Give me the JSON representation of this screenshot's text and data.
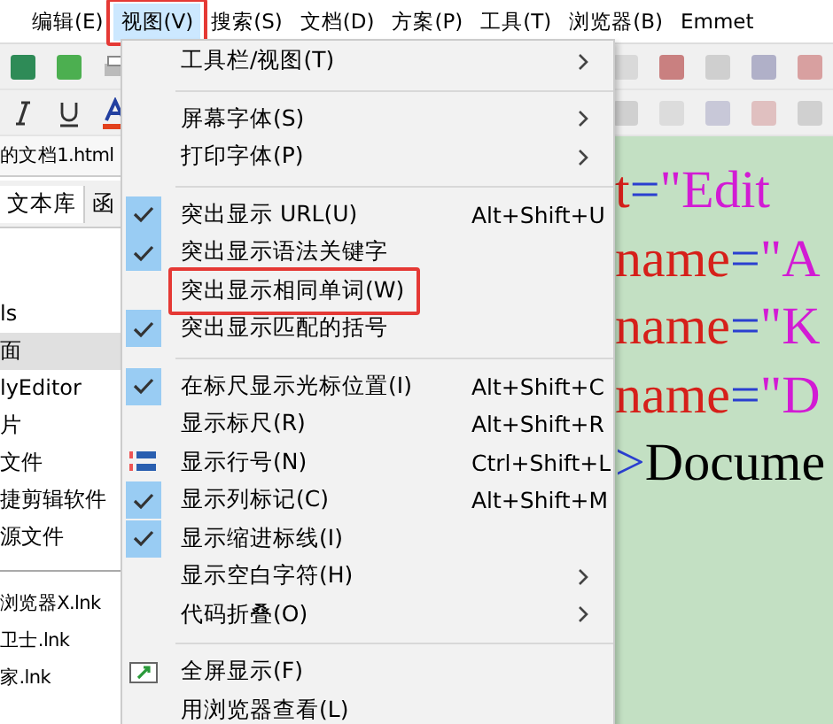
{
  "menu_bar": [
    {
      "label": "编辑(E)",
      "selected": false
    },
    {
      "label": "视图(V)",
      "selected": true
    },
    {
      "label": "搜索(S)",
      "selected": false
    },
    {
      "label": "文档(D)",
      "selected": false
    },
    {
      "label": "方案(P)",
      "selected": false
    },
    {
      "label": "工具(T)",
      "selected": false
    },
    {
      "label": "浏览器(B)",
      "selected": false
    },
    {
      "label": "Emmet",
      "selected": false
    }
  ],
  "file_tab": {
    "label": "的文档1.html"
  },
  "side_tabs": [
    {
      "label": "文本库",
      "selected": true
    },
    {
      "label": "函",
      "selected": false
    }
  ],
  "file_list": [
    {
      "label": "ls",
      "selected": false
    },
    {
      "label": "面",
      "selected": true
    },
    {
      "label": "lyEditor",
      "selected": false
    },
    {
      "label": "片",
      "selected": false
    },
    {
      "label": "文件",
      "selected": false
    },
    {
      "label": "捷剪辑软件",
      "selected": false
    },
    {
      "label": "源文件",
      "selected": false
    }
  ],
  "shortcut_list": [
    {
      "label": "浏览器X.lnk"
    },
    {
      "label": "卫士.lnk"
    },
    {
      "label": "家.lnk"
    }
  ],
  "editor_lines": [
    {
      "kind": "attr",
      "name": "t",
      "op": "=",
      "value": "\"Edit"
    },
    {
      "kind": "attr",
      "name": "name",
      "op": "=",
      "value": "\"A"
    },
    {
      "kind": "attr",
      "name": "name",
      "op": "=",
      "value": "\"K"
    },
    {
      "kind": "attr",
      "name": "name",
      "op": "=",
      "value": "\"D"
    },
    {
      "kind": "tag",
      "name": ">",
      "value": "Docume"
    }
  ],
  "view_menu": [
    {
      "kind": "item",
      "label": "工具栏/视图(T)",
      "submenu": true,
      "checked": false
    },
    {
      "kind": "separator"
    },
    {
      "kind": "item",
      "label": "屏幕字体(S)",
      "submenu": true,
      "checked": false
    },
    {
      "kind": "item",
      "label": "打印字体(P)",
      "submenu": true,
      "checked": false
    },
    {
      "kind": "separator"
    },
    {
      "kind": "item",
      "label": "突出显示 URL(U)",
      "shortcut": "Alt+Shift+U",
      "submenu": false,
      "checked": true
    },
    {
      "kind": "item",
      "label": "突出显示语法关键字",
      "submenu": false,
      "checked": true
    },
    {
      "kind": "item",
      "label": "突出显示相同单词(W)",
      "submenu": false,
      "checked": false,
      "highlighted": true
    },
    {
      "kind": "item",
      "label": "突出显示匹配的括号",
      "submenu": false,
      "checked": true
    },
    {
      "kind": "separator"
    },
    {
      "kind": "item",
      "label": "在标尺显示光标位置(I)",
      "shortcut": "Alt+Shift+C",
      "submenu": false,
      "checked": true
    },
    {
      "kind": "item",
      "label": "显示标尺(R)",
      "shortcut": "Alt+Shift+R",
      "submenu": false,
      "checked": false
    },
    {
      "kind": "numbers",
      "label": "显示行号(N)",
      "shortcut": "Ctrl+Shift+L"
    },
    {
      "kind": "item",
      "label": "显示列标记(C)",
      "shortcut": "Alt+Shift+M",
      "submenu": false,
      "checked": true
    },
    {
      "kind": "item",
      "label": "显示缩进标线(I)",
      "submenu": false,
      "checked": true
    },
    {
      "kind": "item",
      "label": "显示空白字符(H)",
      "submenu": true,
      "checked": false
    },
    {
      "kind": "item",
      "label": "代码折叠(O)",
      "submenu": true,
      "checked": false
    },
    {
      "kind": "separator"
    },
    {
      "kind": "screen",
      "label": "全屏显示(F)"
    },
    {
      "kind": "item",
      "label": "用浏览器查看(L)",
      "submenu": false,
      "checked": false
    }
  ]
}
